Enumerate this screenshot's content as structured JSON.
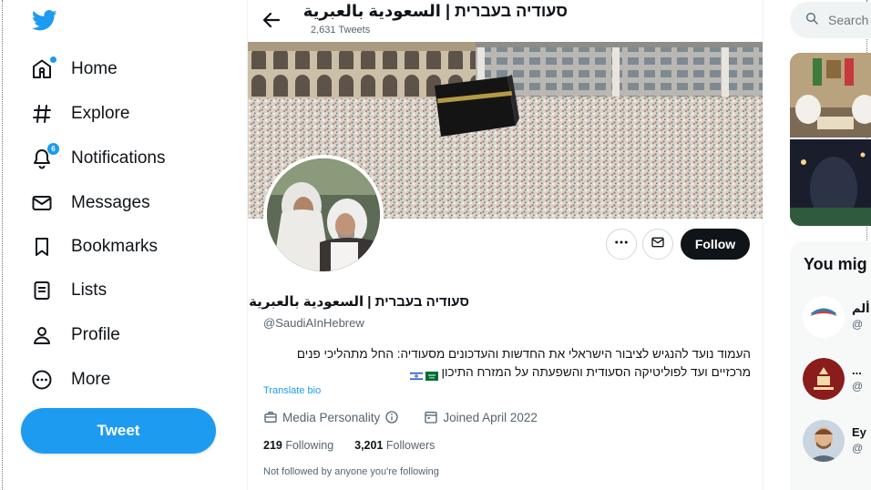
{
  "sidebar": {
    "items": [
      {
        "label": "Home",
        "icon": "home-icon"
      },
      {
        "label": "Explore",
        "icon": "hashtag-icon"
      },
      {
        "label": "Notifications",
        "icon": "bell-icon",
        "badge": "6"
      },
      {
        "label": "Messages",
        "icon": "envelope-icon"
      },
      {
        "label": "Bookmarks",
        "icon": "bookmark-icon"
      },
      {
        "label": "Lists",
        "icon": "list-icon"
      },
      {
        "label": "Profile",
        "icon": "person-icon"
      },
      {
        "label": "More",
        "icon": "more-circle-icon"
      }
    ],
    "tweet_label": "Tweet"
  },
  "header": {
    "title": "סעודיה בעברית | السعودية بالعبرية",
    "tweet_count": "2,631 Tweets"
  },
  "profile": {
    "display_name": "סעודיה בעברית | السعودية بالعبرية",
    "handle": "@SaudiAInHebrew",
    "bio": "העמוד נועד להנגיש לציבור הישראלי את החדשות והעדכונים מסעודיה: החל מתהליכי פנים מרכזיים ועד לפוליטיקה הסעודית והשפעתה על המזרח התיכון",
    "translate_label": "Translate bio",
    "category": "Media Personality",
    "joined": "Joined April 2022",
    "following_count": "219",
    "following_label": "Following",
    "followers_count": "3,201",
    "followers_label": "Followers",
    "followed_note": "Not followed by anyone you're following",
    "follow_label": "Follow"
  },
  "right": {
    "search_placeholder": "Search",
    "wtf_title": "You mig",
    "suggestions": [
      {
        "name": "ألم",
        "handle": "@"
      },
      {
        "name": "...",
        "handle": "@"
      },
      {
        "name": "Ey",
        "handle": "@"
      }
    ]
  },
  "colors": {
    "accent": "#1d9bf0",
    "text_primary": "#0f1419",
    "text_secondary": "#536471",
    "follow_button": "#0f1419"
  }
}
